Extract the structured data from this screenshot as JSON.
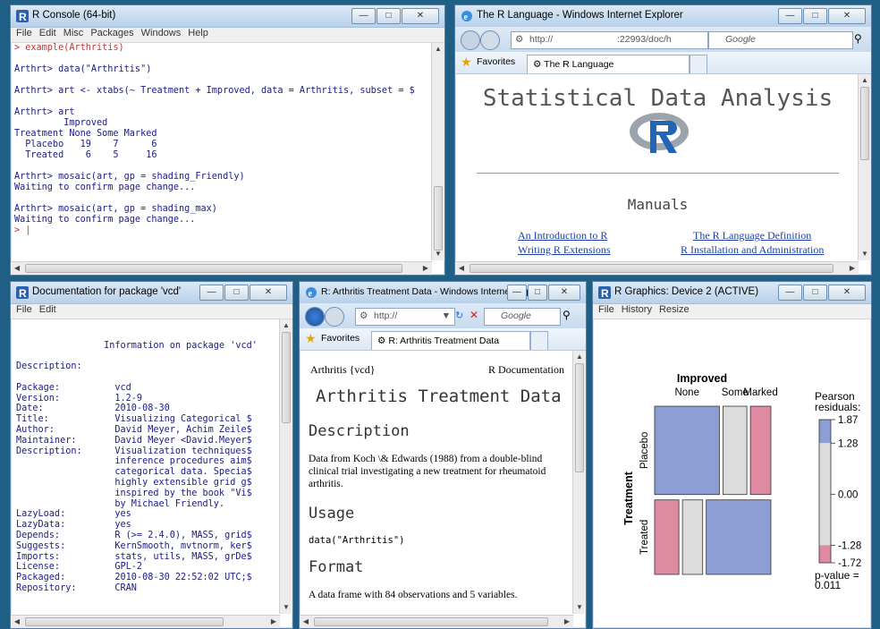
{
  "console": {
    "title": "R Console (64-bit)",
    "menu": [
      "File",
      "Edit",
      "Misc",
      "Packages",
      "Windows",
      "Help"
    ],
    "lines": [
      {
        "text": "> example(Arthritis)",
        "red": true
      },
      {
        "text": "",
        "red": false
      },
      {
        "text": "Arthrt> data(\"Arthritis\")",
        "red": false
      },
      {
        "text": "",
        "red": false
      },
      {
        "text": "Arthrt> art <- xtabs(~ Treatment + Improved, data = Arthritis, subset = $",
        "red": false
      },
      {
        "text": "",
        "red": false
      },
      {
        "text": "Arthrt> art",
        "red": false
      },
      {
        "text": "         Improved",
        "red": false
      },
      {
        "text": "Treatment None Some Marked",
        "red": false
      },
      {
        "text": "  Placebo   19    7      6",
        "red": false
      },
      {
        "text": "  Treated    6    5     16",
        "red": false
      },
      {
        "text": "",
        "red": false
      },
      {
        "text": "Arthrt> mosaic(art, gp = shading_Friendly)",
        "red": false
      },
      {
        "text": "Waiting to confirm page change...",
        "red": false
      },
      {
        "text": "",
        "red": false
      },
      {
        "text": "Arthrt> mosaic(art, gp = shading_max)",
        "red": false
      },
      {
        "text": "Waiting to confirm page change...",
        "red": false
      },
      {
        "text": "> |",
        "red": true
      }
    ]
  },
  "ie1": {
    "title": "The R Language - Windows Internet Explorer",
    "address_left": "http://",
    "address_right": ":22993/doc/h",
    "search": "Google",
    "favorites": "Favorites",
    "tab": "The R Language",
    "heading": "Statistical Data Analysis",
    "section": "Manuals",
    "links": [
      "An Introduction to R",
      "The R Language Definition",
      "Writing R Extensions",
      "R Installation and Administration"
    ]
  },
  "vcd": {
    "title": "Documentation for package 'vcd'",
    "menu": [
      "File",
      "Edit"
    ],
    "lines": [
      "",
      "",
      "                Information on package 'vcd'",
      "",
      "Description:",
      "",
      "Package:          vcd",
      "Version:          1.2-9",
      "Date:             2010-08-30",
      "Title:            Visualizing Categorical $",
      "Author:           David Meyer, Achim Zeile$",
      "Maintainer:       David Meyer <David.Meyer$",
      "Description:      Visualization techniques$",
      "                  inference procedures aim$",
      "                  categorical data. Specia$",
      "                  highly extensible grid g$",
      "                  inspired by the book \"Vi$",
      "                  by Michael Friendly.",
      "LazyLoad:         yes",
      "LazyData:         yes",
      "Depends:          R (>= 2.4.0), MASS, grid$",
      "Suggests:         KernSmooth, mvtnorm, ker$",
      "Imports:          stats, utils, MASS, grDe$",
      "License:          GPL-2",
      "Packaged:         2010-08-30 22:52:02 UTC;$",
      "Repository:       CRAN"
    ]
  },
  "ie2": {
    "title": "R: Arthritis Treatment Data - Windows Internet Explo...",
    "address": "http://",
    "search": "Google",
    "favorites": "Favorites",
    "tab": "R: Arthritis Treatment Data",
    "doc_left": "Arthritis {vcd}",
    "doc_right": "R Documentation",
    "heading": "Arthritis Treatment Data",
    "h_description": "Description",
    "description": "Data from Koch \\& Edwards (1988) from a double-blind clinical trial investigating a new treatment for rheumatoid arthritis.",
    "h_usage": "Usage",
    "usage": "data(\"Arthritis\")",
    "h_format": "Format",
    "format": "A data frame with 84 observations and 5 variables."
  },
  "graphics": {
    "title": "R Graphics: Device 2 (ACTIVE)",
    "menu": [
      "File",
      "History",
      "Resize"
    ]
  },
  "chart_data": {
    "type": "mosaic",
    "title": "Improved",
    "column_labels": [
      "None",
      "Some",
      "Marked"
    ],
    "row_title": "Treatment",
    "row_labels": [
      "Placebo",
      "Treated"
    ],
    "counts": {
      "Placebo": [
        19,
        7,
        6
      ],
      "Treated": [
        6,
        5,
        16
      ]
    },
    "legend_title": "Pearson residuals:",
    "legend_ticks": [
      "1.87",
      "1.28",
      "0.00",
      "-1.28",
      "-1.72"
    ],
    "p_value_label": "p-value =",
    "p_value": "0.011",
    "colors": {
      "positive": "#8c9ed4",
      "neutral": "#dcdcdc",
      "negative": "#de8aa0"
    },
    "cell_shading": {
      "Placebo": [
        "positive",
        "neutral",
        "negative"
      ],
      "Treated": [
        "negative",
        "neutral",
        "positive"
      ]
    }
  }
}
